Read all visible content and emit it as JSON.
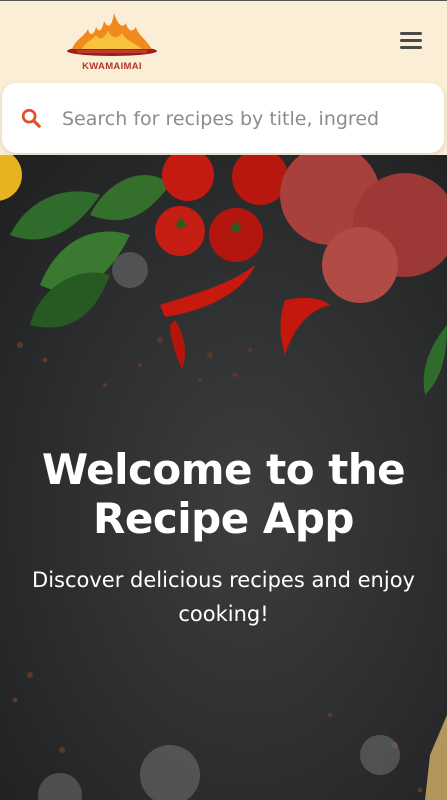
{
  "header": {
    "logo_text": "KWAMAIMAI",
    "menu_icon": "hamburger-menu-icon"
  },
  "search": {
    "icon": "search-icon",
    "placeholder": "Search for recipes by title, ingred",
    "value": ""
  },
  "hero": {
    "title": "Welcome to the Recipe App",
    "subtitle": "Discover delicious recipes and enjoy cooking!"
  },
  "colors": {
    "header_bg": "#fbeed6",
    "accent": "#e0502a",
    "hero_bg": "#2b2d2f"
  }
}
